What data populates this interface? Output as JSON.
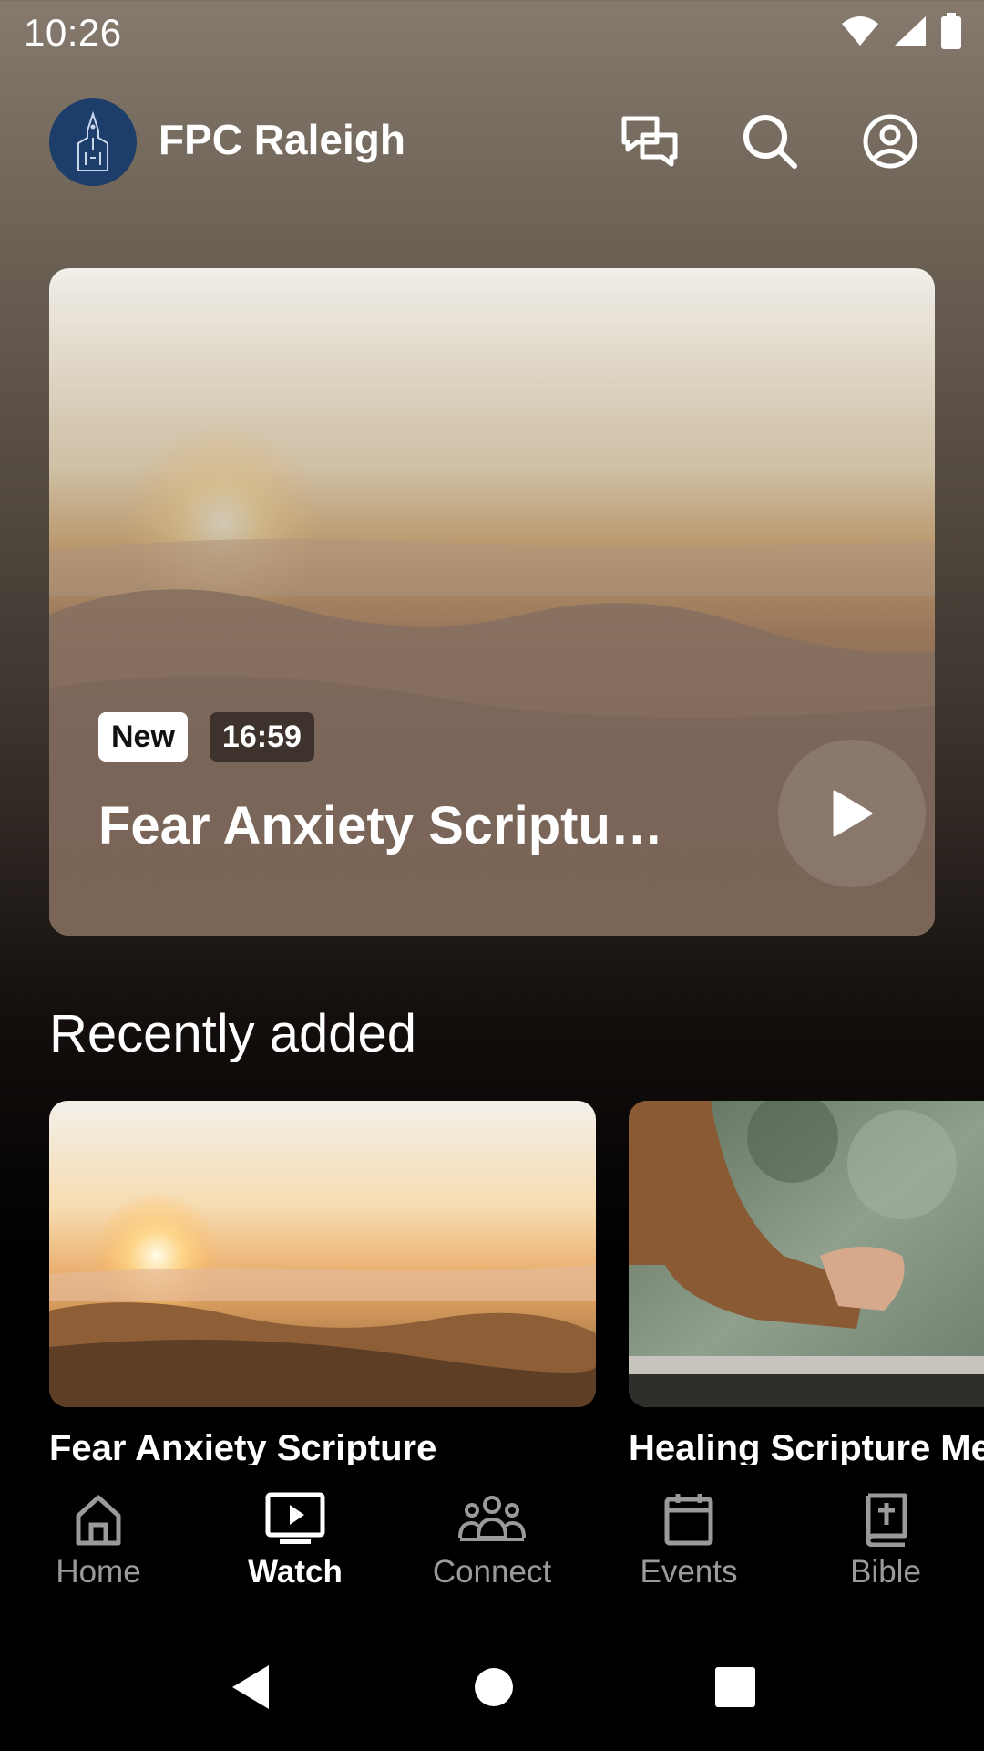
{
  "status_bar": {
    "time": "10:26"
  },
  "header": {
    "app_name": "FPC Raleigh",
    "icons": [
      "chat-icon",
      "search-icon",
      "account-icon"
    ]
  },
  "hero": {
    "badge_new": "New",
    "duration": "16:59",
    "title": "Fear Anxiety Scriptur…"
  },
  "recently_added": {
    "heading": "Recently added",
    "items": [
      {
        "title": "Fear Anxiety Scripture"
      },
      {
        "title": "Healing Scripture Me"
      }
    ]
  },
  "bottom_nav": {
    "items": [
      {
        "label": "Home",
        "icon": "home-icon",
        "active": false
      },
      {
        "label": "Watch",
        "icon": "tv-play-icon",
        "active": true
      },
      {
        "label": "Connect",
        "icon": "group-icon",
        "active": false
      },
      {
        "label": "Events",
        "icon": "calendar-icon",
        "active": false
      },
      {
        "label": "Bible",
        "icon": "bible-icon",
        "active": false
      }
    ]
  },
  "colors": {
    "logo_bg": "#1d3d6b",
    "active": "#ffffff",
    "inactive": "#9a9a9a"
  }
}
